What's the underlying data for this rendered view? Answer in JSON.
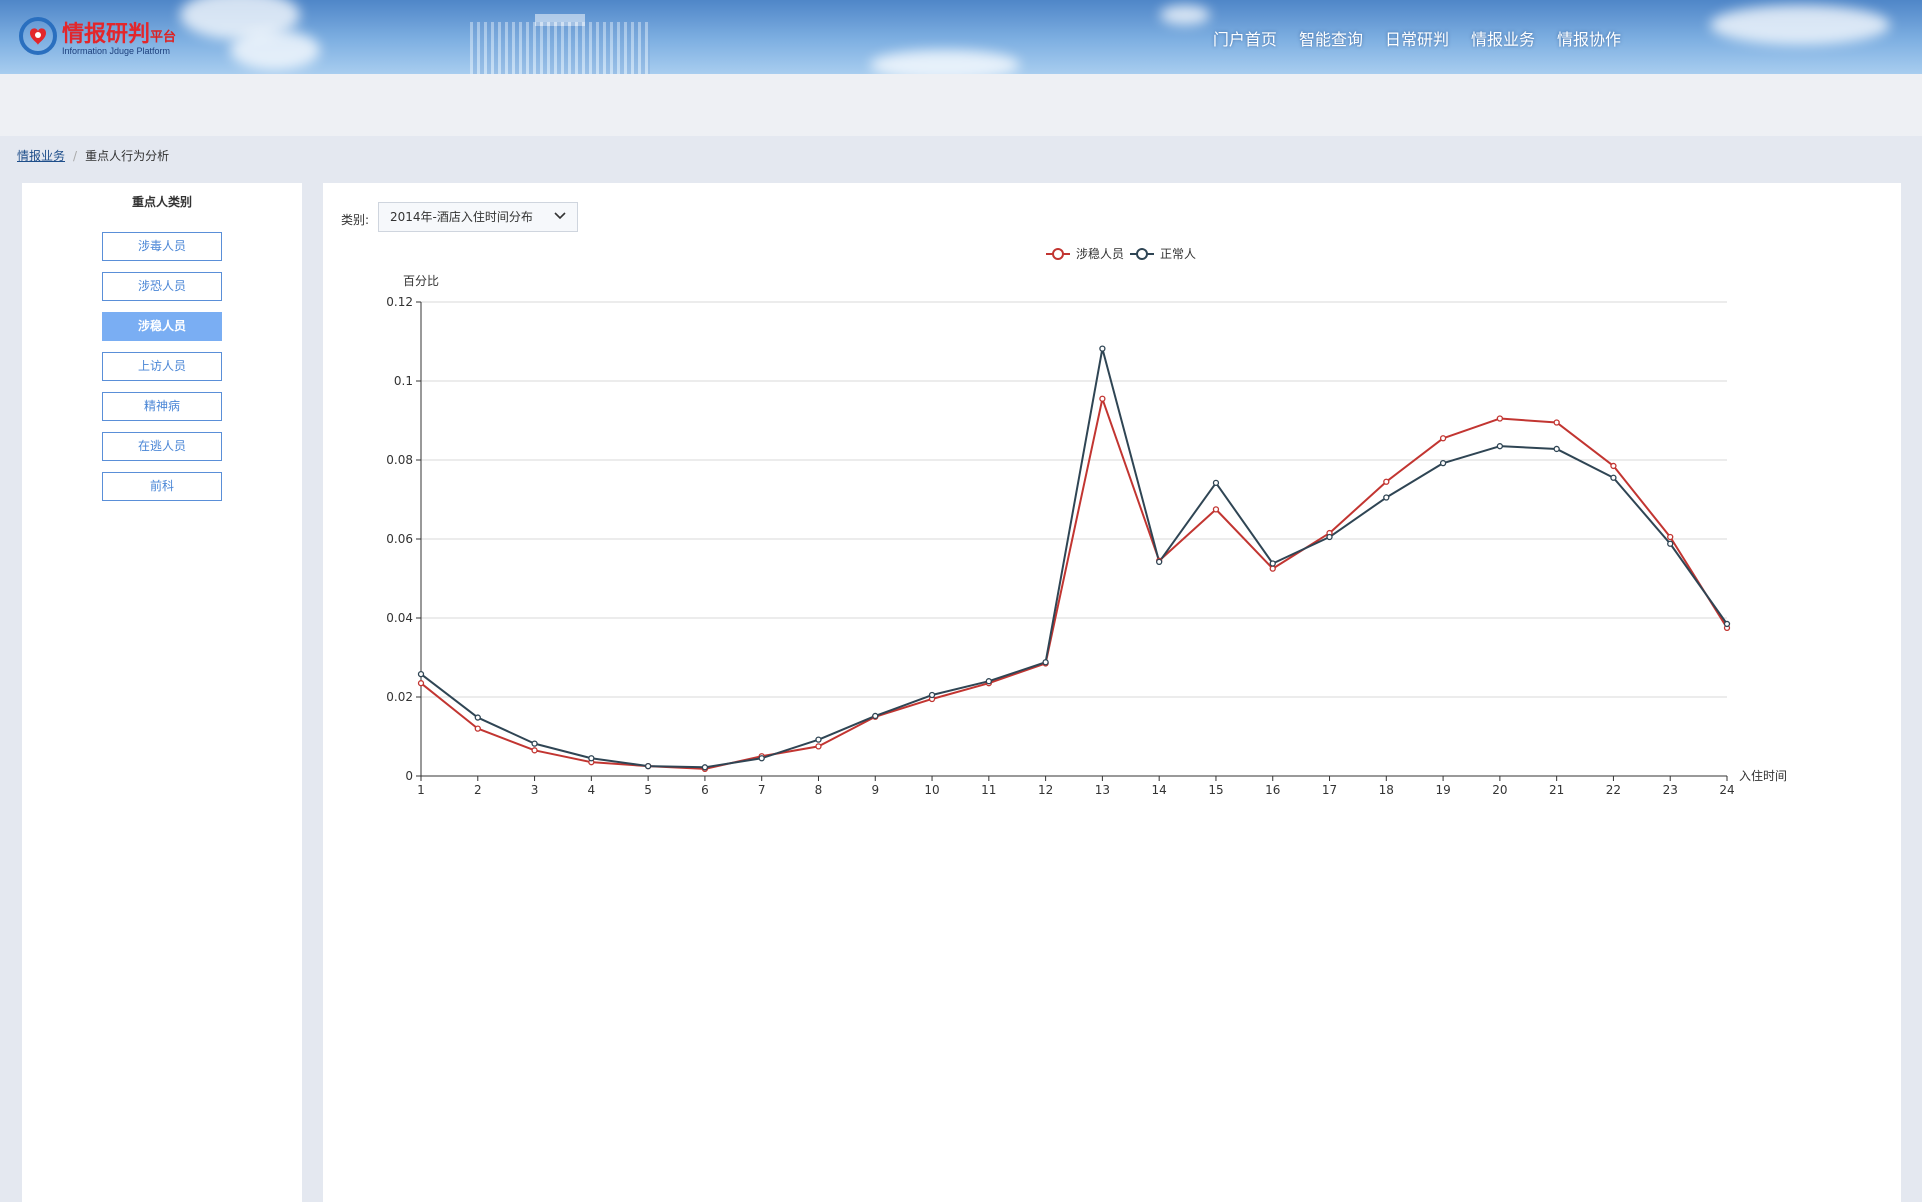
{
  "header": {
    "logo_title": "情报研判",
    "logo_title_small": "平台",
    "logo_subtitle": "Information Jduge Platform",
    "nav": [
      "门户首页",
      "智能查询",
      "日常研判",
      "情报业务",
      "情报协作"
    ]
  },
  "breadcrumb": {
    "parent": "情报业务",
    "separator": "/",
    "current": "重点人行为分析"
  },
  "sidebar": {
    "title": "重点人类别",
    "items": [
      {
        "label": "涉毒人员",
        "active": false
      },
      {
        "label": "涉恐人员",
        "active": false
      },
      {
        "label": "涉稳人员",
        "active": true
      },
      {
        "label": "上访人员",
        "active": false
      },
      {
        "label": "精神病",
        "active": false
      },
      {
        "label": "在逃人员",
        "active": false
      },
      {
        "label": "前科",
        "active": false
      }
    ]
  },
  "filter": {
    "label": "类别:",
    "selected": "2014年-酒店入住时间分布"
  },
  "colors": {
    "series_1": "#c23531",
    "series_2": "#2f4554",
    "accent": "#7aaef3"
  },
  "chart_data": {
    "type": "line",
    "title": "",
    "xlabel": "入住时间",
    "ylabel": "百分比",
    "legend_position": "top-center",
    "grid": true,
    "ylim": [
      0,
      0.12
    ],
    "yticks": [
      "0",
      "0.02",
      "0.04",
      "0.06",
      "0.08",
      "0.1",
      "0.12"
    ],
    "x": [
      1,
      2,
      3,
      4,
      5,
      6,
      7,
      8,
      9,
      10,
      11,
      12,
      13,
      14,
      15,
      16,
      17,
      18,
      19,
      20,
      21,
      22,
      23,
      24
    ],
    "series": [
      {
        "name": "涉稳人员",
        "color": "#c23531",
        "values": [
          0.0235,
          0.012,
          0.0065,
          0.0035,
          0.0025,
          0.0018,
          0.005,
          0.0075,
          0.015,
          0.0195,
          0.0235,
          0.0285,
          0.0955,
          0.0545,
          0.0675,
          0.0525,
          0.0615,
          0.0745,
          0.0855,
          0.0905,
          0.0895,
          0.0785,
          0.0605,
          0.0375
        ]
      },
      {
        "name": "正常人",
        "color": "#2f4554",
        "values": [
          0.0258,
          0.0148,
          0.0082,
          0.0045,
          0.0025,
          0.0022,
          0.0045,
          0.0092,
          0.0152,
          0.0205,
          0.024,
          0.0288,
          0.1082,
          0.0542,
          0.0742,
          0.0538,
          0.0605,
          0.0705,
          0.0792,
          0.0835,
          0.0828,
          0.0755,
          0.0588,
          0.0385
        ]
      }
    ]
  }
}
